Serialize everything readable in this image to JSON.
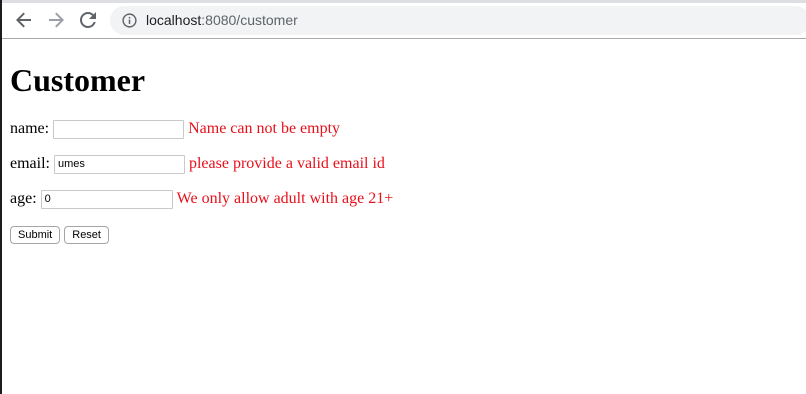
{
  "browser": {
    "url_host": "localhost",
    "url_rest": ":8080/customer",
    "icons": {
      "back": "back-arrow-icon",
      "forward": "forward-arrow-icon",
      "reload": "reload-icon",
      "info": "info-icon"
    }
  },
  "page": {
    "title": "Customer"
  },
  "form": {
    "name": {
      "label": "name:",
      "value": "",
      "error": "Name can not be empty"
    },
    "email": {
      "label": "email:",
      "value": "umes",
      "error": "please provide a valid email id"
    },
    "age": {
      "label": "age:",
      "value": "0",
      "error": "We only allow adult with age 21+"
    },
    "submit_label": "Submit",
    "reset_label": "Reset"
  },
  "colors": {
    "error": "#e8101a",
    "omnibox_bg": "#f1f3f4"
  }
}
